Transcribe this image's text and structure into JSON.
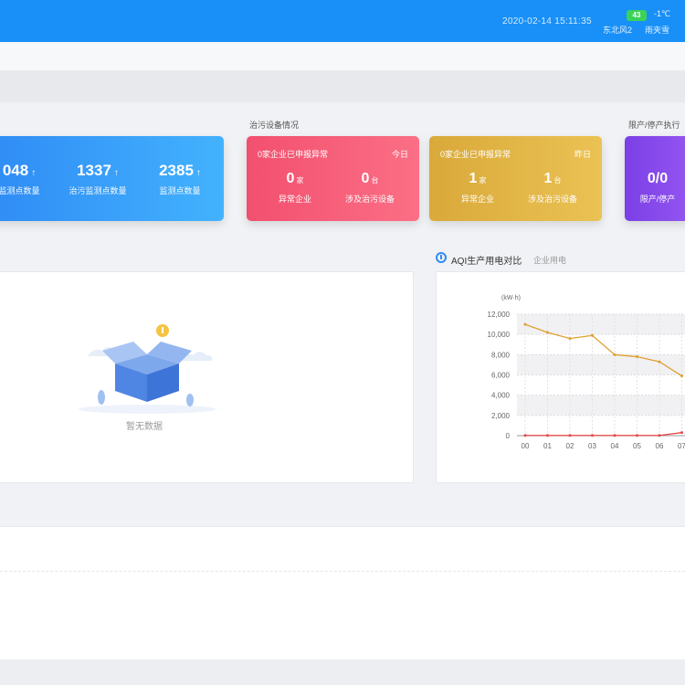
{
  "header": {
    "datetime": "2020-02-14  15:11:35",
    "aqi_value": "43",
    "temperature": "-1℃",
    "wind": "东北风2",
    "weather": "雨夹雪"
  },
  "sections": {
    "pollution_equipment": "治污设备情况",
    "stop_production": "限产/停产执行"
  },
  "monitor_card": {
    "stats": [
      {
        "value": "048",
        "label": "监测点数量"
      },
      {
        "value": "1337",
        "label": "治污监测点数量"
      },
      {
        "value": "2385",
        "label": "监测点数量"
      }
    ],
    "arrow": "↑"
  },
  "red_card": {
    "head": "0家企业已申报异常",
    "tag": "今日",
    "left_value": "0",
    "left_unit": "家",
    "left_label": "异常企业",
    "right_value": "0",
    "right_unit": "台",
    "right_label": "涉及治污设备"
  },
  "yellow_card": {
    "head": "0家企业已申报异常",
    "tag": "昨日",
    "left_value": "1",
    "left_unit": "家",
    "left_label": "异常企业",
    "right_value": "1",
    "right_unit": "台",
    "right_label": "涉及治污设备"
  },
  "purple_card": {
    "value": "0/0",
    "label": "限产/停产"
  },
  "empty_panel": {
    "text": "暂无数据"
  },
  "chart_panel": {
    "title": "AQI生产用电对比",
    "subtitle": "企业用电"
  },
  "chart_data": {
    "type": "line",
    "ylabel": "(kW·h)",
    "xlabel": "",
    "ylim": [
      0,
      12000
    ],
    "y_ticks": [
      "0",
      "2,000",
      "4,000",
      "6,000",
      "8,000",
      "10,000",
      "12,000"
    ],
    "categories": [
      "00",
      "01",
      "02",
      "03",
      "04",
      "05",
      "06",
      "07"
    ],
    "series": [
      {
        "values": [
          11000,
          10200,
          9600,
          9900,
          8000,
          7800,
          7300,
          5900
        ],
        "color": "#e0a030"
      },
      {
        "values": [
          20,
          20,
          20,
          20,
          20,
          20,
          20,
          300
        ],
        "color": "#e84545"
      }
    ],
    "grid": true
  },
  "colors": {
    "accent": "#1890f7",
    "blue_card": "#3a9cf7",
    "red_card": "#f55d78",
    "yellow_card": "#e0b448",
    "purple_card": "#8a4dee"
  }
}
